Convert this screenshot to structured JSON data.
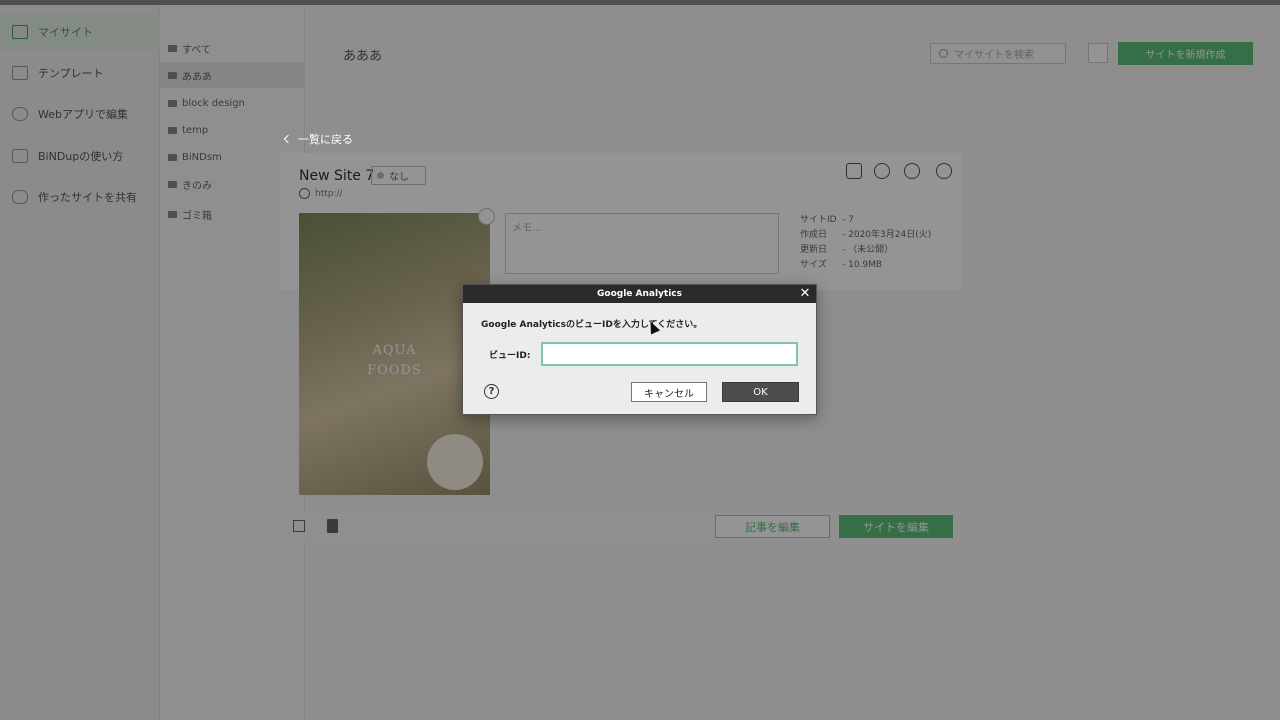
{
  "left_nav": {
    "items": [
      {
        "label": "マイサイト",
        "icon": "pencil-icon",
        "active": true
      },
      {
        "label": "テンプレート",
        "icon": "template-icon"
      },
      {
        "label": "Webアプリで編集",
        "icon": "cloud-icon"
      },
      {
        "label": "BiNDupの使い方",
        "icon": "book-icon"
      },
      {
        "label": "作ったサイトを共有",
        "icon": "people-icon"
      }
    ]
  },
  "folders": {
    "items": [
      {
        "label": "すべて"
      },
      {
        "label": "あああ",
        "active": true
      },
      {
        "label": "block design"
      },
      {
        "label": "temp"
      },
      {
        "label": "BiNDsm"
      },
      {
        "label": "きのみ"
      },
      {
        "label": "ゴミ箱"
      }
    ]
  },
  "main": {
    "title": "あああ",
    "search_placeholder": "マイサイトを検索",
    "new_site_label": "サイトを新規作成"
  },
  "site": {
    "back_label": "一覧に戻る",
    "name": "New Site 7",
    "tag": "なし",
    "url": "http://",
    "memo_placeholder": "メモ...",
    "info": [
      {
        "key": "サイトID",
        "value": "- 7"
      },
      {
        "key": "作成日",
        "value": "- 2020年3月24日(火)"
      },
      {
        "key": "更新日",
        "value": "- （未公開）"
      },
      {
        "key": "サイズ",
        "value": "- 10.9MB"
      }
    ],
    "thumbnail_title_line1": "AQUA",
    "thumbnail_title_line2": "FOODS",
    "edit_article_label": "記事を編集",
    "edit_site_label": "サイトを編集"
  },
  "dialog": {
    "title": "Google Analytics",
    "message": "Google AnalyticsのビューIDを入力してください。",
    "field_label": "ビューID:",
    "field_value": "",
    "cancel_label": "キャンセル",
    "ok_label": "OK",
    "help_glyph": "?",
    "close_glyph": "✕"
  },
  "colors": {
    "accent_green": "#5dbd7a",
    "dialog_titlebar": "#2a2a2a",
    "ok_button": "#4d4d4d",
    "input_focus": "#7fc6a8"
  }
}
